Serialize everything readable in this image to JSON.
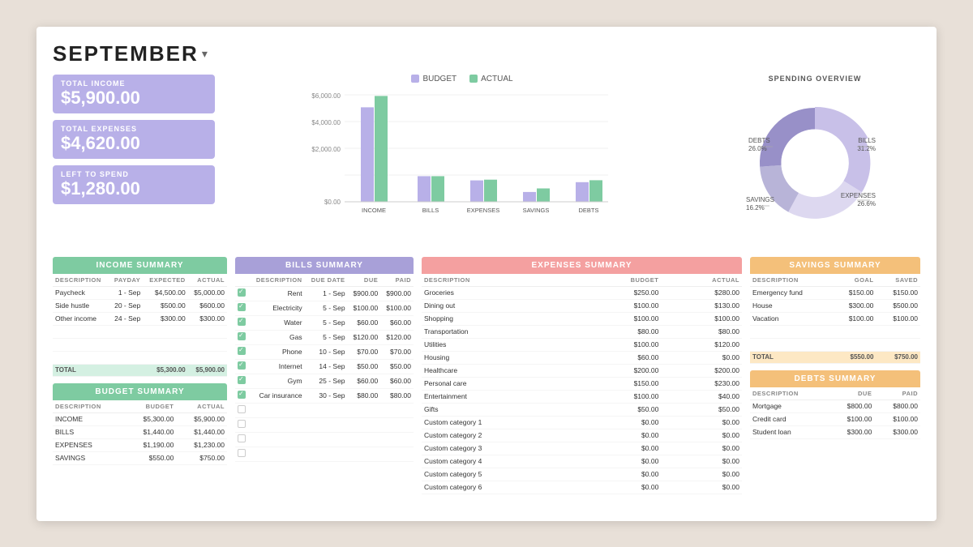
{
  "header": {
    "month": "SEPTEMBER",
    "arrow": "▾"
  },
  "kpis": {
    "income": {
      "label": "TOTAL INCOME",
      "value": "$5,900.00"
    },
    "expenses": {
      "label": "TOTAL EXPENSES",
      "value": "$4,620.00"
    },
    "left": {
      "label": "LEFT TO SPEND",
      "value": "$1,280.00"
    }
  },
  "chart": {
    "legend": [
      {
        "label": "BUDGET",
        "color": "#b8b0e8"
      },
      {
        "label": "ACTUAL",
        "color": "#7ecba1"
      }
    ],
    "yLabels": [
      "$6,000.00",
      "$4,000.00",
      "$2,000.00",
      "$0.00"
    ],
    "bars": [
      {
        "label": "INCOME",
        "budget": 5300,
        "actual": 5900
      },
      {
        "label": "BILLS",
        "budget": 1440,
        "actual": 1440
      },
      {
        "label": "EXPENSES",
        "budget": 1190,
        "actual": 1230
      },
      {
        "label": "SAVINGS",
        "budget": 550,
        "actual": 750
      },
      {
        "label": "DEBTS",
        "budget": 1100,
        "actual": 1200
      }
    ]
  },
  "donut": {
    "title": "SPENDING OVERVIEW",
    "segments": [
      {
        "label": "BILLS",
        "percent": 31.2,
        "color": "#c8c0e8"
      },
      {
        "label": "EXPENSES",
        "percent": 26.6,
        "color": "#e8e4f4"
      },
      {
        "label": "SAVINGS",
        "percent": 16.2,
        "color": "#d4cfe8"
      },
      {
        "label": "DEBTS",
        "percent": 26.0,
        "color": "#b0a8d8"
      }
    ]
  },
  "income_summary": {
    "title": "INCOME SUMMARY",
    "headers": [
      "DESCRIPTION",
      "PAYDAY",
      "EXPECTED",
      "ACTUAL"
    ],
    "rows": [
      {
        "desc": "Paycheck",
        "payday": "1 - Sep",
        "expected": "$4,500.00",
        "actual": "$5,000.00"
      },
      {
        "desc": "Side hustle",
        "payday": "20 - Sep",
        "expected": "$500.00",
        "actual": "$600.00"
      },
      {
        "desc": "Other income",
        "payday": "24 - Sep",
        "expected": "$300.00",
        "actual": "$300.00"
      }
    ],
    "total": {
      "label": "TOTAL",
      "expected": "$5,300.00",
      "actual": "$5,900.00"
    }
  },
  "budget_summary": {
    "title": "BUDGET SUMMARY",
    "headers": [
      "DESCRIPTION",
      "BUDGET",
      "ACTUAL"
    ],
    "rows": [
      {
        "desc": "INCOME",
        "budget": "$5,300.00",
        "actual": "$5,900.00"
      },
      {
        "desc": "BILLS",
        "budget": "$1,440.00",
        "actual": "$1,440.00"
      },
      {
        "desc": "EXPENSES",
        "budget": "$1,190.00",
        "actual": "$1,230.00"
      },
      {
        "desc": "SAVINGS",
        "budget": "$550.00",
        "actual": "$750.00"
      }
    ]
  },
  "bills_summary": {
    "title": "BILLS SUMMARY",
    "headers": [
      "DESCRIPTION",
      "DUE DATE",
      "DUE",
      "PAID"
    ],
    "rows": [
      {
        "desc": "Rent",
        "checked": true,
        "due_date": "1 - Sep",
        "due": "$900.00",
        "paid": "$900.00"
      },
      {
        "desc": "Electricity",
        "checked": true,
        "due_date": "5 - Sep",
        "due": "$100.00",
        "paid": "$100.00"
      },
      {
        "desc": "Water",
        "checked": true,
        "due_date": "5 - Sep",
        "due": "$60.00",
        "paid": "$60.00"
      },
      {
        "desc": "Gas",
        "checked": true,
        "due_date": "5 - Sep",
        "due": "$120.00",
        "paid": "$120.00"
      },
      {
        "desc": "Phone",
        "checked": true,
        "due_date": "10 - Sep",
        "due": "$70.00",
        "paid": "$70.00"
      },
      {
        "desc": "Internet",
        "checked": true,
        "due_date": "14 - Sep",
        "due": "$50.00",
        "paid": "$50.00"
      },
      {
        "desc": "Gym",
        "checked": true,
        "due_date": "25 - Sep",
        "due": "$60.00",
        "paid": "$60.00"
      },
      {
        "desc": "Car insurance",
        "checked": true,
        "due_date": "30 - Sep",
        "due": "$80.00",
        "paid": "$80.00"
      },
      {
        "desc": "",
        "checked": false,
        "due_date": "",
        "due": "",
        "paid": ""
      },
      {
        "desc": "",
        "checked": false,
        "due_date": "",
        "due": "",
        "paid": ""
      },
      {
        "desc": "",
        "checked": false,
        "due_date": "",
        "due": "",
        "paid": ""
      },
      {
        "desc": "",
        "checked": false,
        "due_date": "",
        "due": "",
        "paid": ""
      }
    ]
  },
  "expenses_summary": {
    "title": "EXPENSES SUMMARY",
    "headers": [
      "DESCRIPTION",
      "BUDGET",
      "ACTUAL"
    ],
    "rows": [
      {
        "desc": "Groceries",
        "budget": "$250.00",
        "actual": "$280.00"
      },
      {
        "desc": "Dining out",
        "budget": "$100.00",
        "actual": "$130.00"
      },
      {
        "desc": "Shopping",
        "budget": "$100.00",
        "actual": "$100.00"
      },
      {
        "desc": "Transportation",
        "budget": "$80.00",
        "actual": "$80.00"
      },
      {
        "desc": "Utilities",
        "budget": "$100.00",
        "actual": "$120.00"
      },
      {
        "desc": "Housing",
        "budget": "$60.00",
        "actual": "$0.00"
      },
      {
        "desc": "Healthcare",
        "budget": "$200.00",
        "actual": "$200.00"
      },
      {
        "desc": "Personal care",
        "budget": "$150.00",
        "actual": "$230.00"
      },
      {
        "desc": "Entertainment",
        "budget": "$100.00",
        "actual": "$40.00"
      },
      {
        "desc": "Gifts",
        "budget": "$50.00",
        "actual": "$50.00"
      },
      {
        "desc": "Custom category 1",
        "budget": "$0.00",
        "actual": "$0.00"
      },
      {
        "desc": "Custom category 2",
        "budget": "$0.00",
        "actual": "$0.00"
      },
      {
        "desc": "Custom category 3",
        "budget": "$0.00",
        "actual": "$0.00"
      },
      {
        "desc": "Custom category 4",
        "budget": "$0.00",
        "actual": "$0.00"
      },
      {
        "desc": "Custom category 5",
        "budget": "$0.00",
        "actual": "$0.00"
      },
      {
        "desc": "Custom category 6",
        "budget": "$0.00",
        "actual": "$0.00"
      }
    ]
  },
  "savings_summary": {
    "title": "SAVINGS SUMMARY",
    "headers": [
      "DESCRIPTION",
      "GOAL",
      "SAVED"
    ],
    "rows": [
      {
        "desc": "Emergency fund",
        "goal": "$150.00",
        "saved": "$150.00"
      },
      {
        "desc": "House",
        "goal": "$300.00",
        "saved": "$500.00"
      },
      {
        "desc": "Vacation",
        "goal": "$100.00",
        "saved": "$100.00"
      }
    ],
    "total": {
      "label": "TOTAL",
      "goal": "$550.00",
      "saved": "$750.00"
    }
  },
  "debts_summary": {
    "title": "DEBTS SUMMARY",
    "headers": [
      "DESCRIPTION",
      "DUE",
      "PAID"
    ],
    "rows": [
      {
        "desc": "Mortgage",
        "due": "$800.00",
        "paid": "$800.00"
      },
      {
        "desc": "Credit card",
        "due": "$100.00",
        "paid": "$100.00"
      },
      {
        "desc": "Student loan",
        "due": "$300.00",
        "paid": "$300.00"
      }
    ]
  }
}
